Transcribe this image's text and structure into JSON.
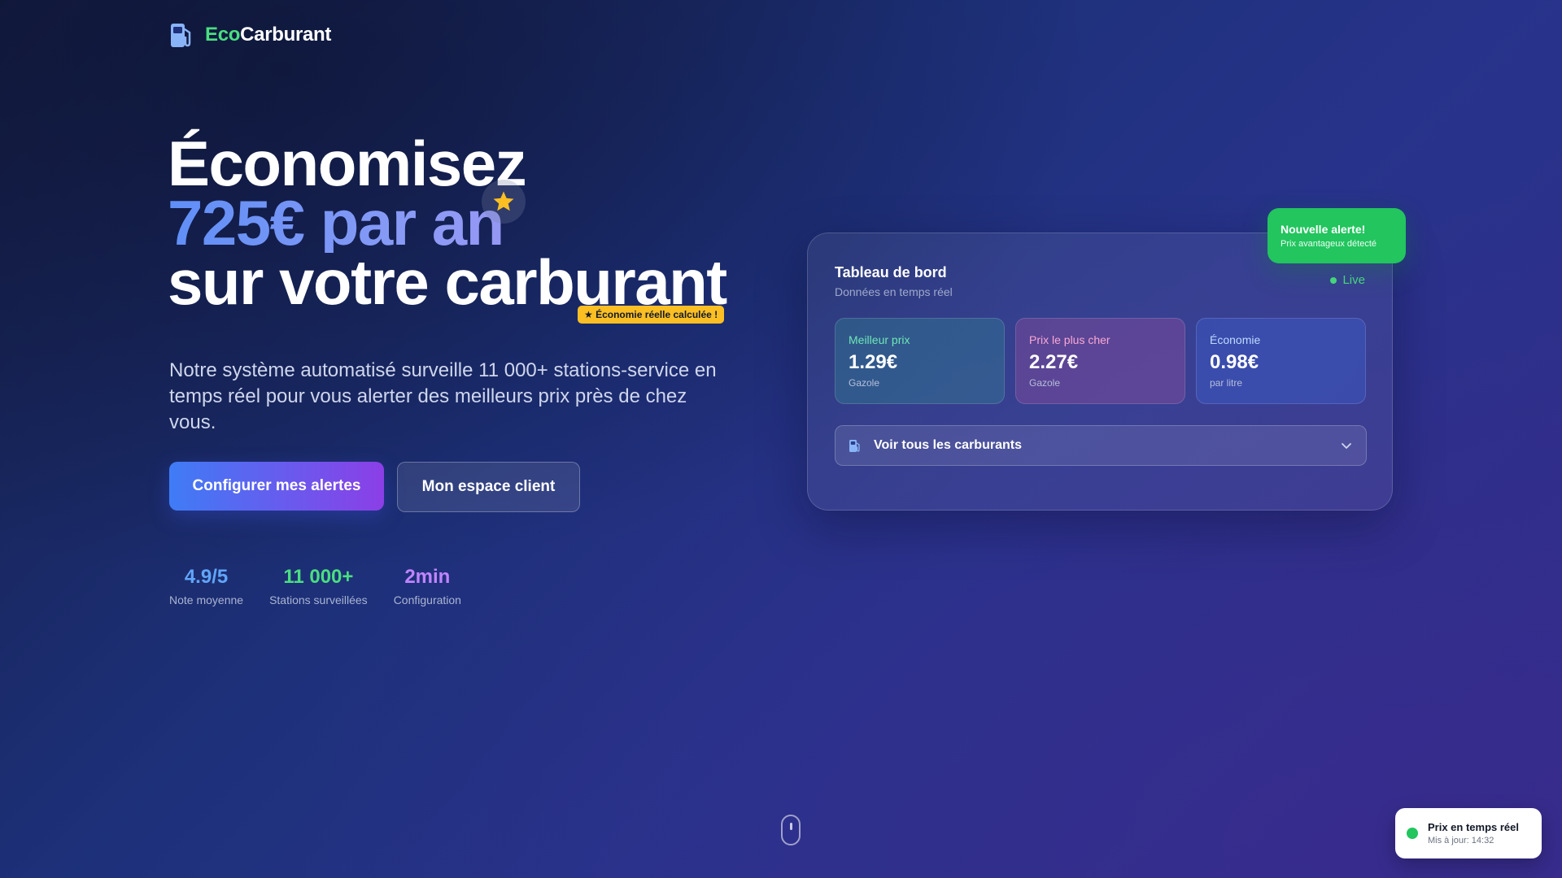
{
  "brand": {
    "prefix": "Eco",
    "suffix": "Carburant",
    "icon": "fuel-pump-icon"
  },
  "hero": {
    "line1": "Économisez",
    "line2": "725€ par an",
    "line3": "sur votre carburant",
    "badge": "★ Économie réelle calculée !",
    "description": "Notre système automatisé surveille 11 000+ stations-service en temps réel pour vous alerter des meilleurs prix près de chez vous.",
    "cta_primary": "Configurer mes alertes",
    "cta_secondary": "Mon espace client"
  },
  "stats": [
    {
      "value": "4.9/5",
      "label": "Note moyenne",
      "color": "#60a5fa"
    },
    {
      "value": "11 000+",
      "label": "Stations surveillées",
      "color": "#4ade80"
    },
    {
      "value": "2min",
      "label": "Configuration",
      "color": "#c084fc"
    }
  ],
  "dashboard": {
    "title": "Tableau de bord",
    "subtitle": "Données en temps réel",
    "live": "Live",
    "cards": [
      {
        "label": "Meilleur prix",
        "value": "1.29€",
        "note": "Gazole"
      },
      {
        "label": "Prix le plus cher",
        "value": "2.27€",
        "note": "Gazole"
      },
      {
        "label": "Économie",
        "value": "0.98€",
        "note": "par litre"
      }
    ],
    "select_label": "Voir tous les carburants"
  },
  "alert": {
    "title": "Nouvelle alerte!",
    "subtitle": "Prix avantageux détecté"
  },
  "toast": {
    "title": "Prix en temps réel",
    "subtitle": "Mis à jour: 14:32"
  },
  "colors": {
    "accent_green": "#22c55e",
    "badge_yellow": "#fbbf24",
    "primary_blue": "#3f7cf6",
    "primary_purple": "#8b3fe6"
  }
}
